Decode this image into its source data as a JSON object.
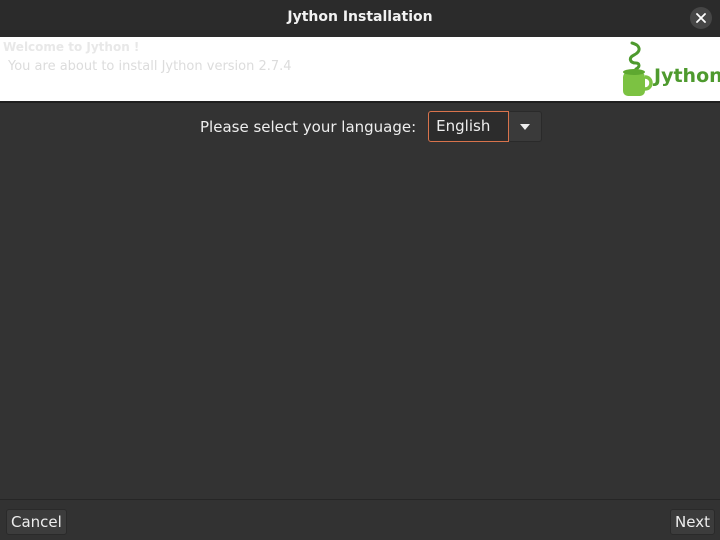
{
  "window": {
    "title": "Jython Installation"
  },
  "banner": {
    "welcome_title": "Welcome to Jython !",
    "welcome_subtitle": "You are about to install Jython version 2.7.4",
    "logo_text": "Jython",
    "logo_color": "#4e9a2e"
  },
  "language": {
    "label": "Please select your language:",
    "selected": "English",
    "focus_color": "#d9734c"
  },
  "footer": {
    "cancel_label": "Cancel",
    "next_label": "Next"
  },
  "icons": {
    "close": "close-icon",
    "dropdown": "chevron-down-icon",
    "logo": "jython-cup-logo"
  }
}
